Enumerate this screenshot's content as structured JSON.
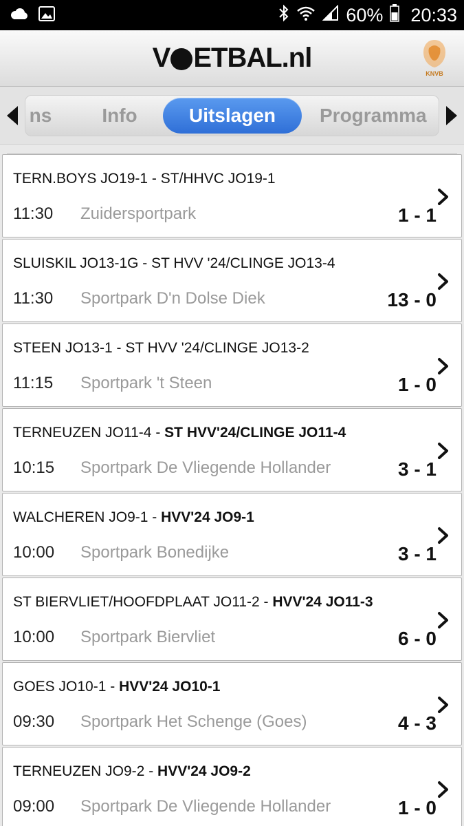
{
  "status_bar": {
    "battery_percent": "60%",
    "time": "20:33",
    "icons": [
      "cloud-icon",
      "image-icon",
      "bluetooth-icon",
      "wifi-icon",
      "signal-icon",
      "battery-icon"
    ]
  },
  "header": {
    "logo_text_pre": "V",
    "logo_text_post": "ETBAL",
    "logo_tld": ".nl",
    "badge_label": "KNVB"
  },
  "tabs": {
    "items": [
      {
        "label": "ns"
      },
      {
        "label": "Info"
      },
      {
        "label": "Uitslagen"
      },
      {
        "label": "Programma"
      }
    ],
    "active": "Uitslagen"
  },
  "matches": [
    {
      "home": "TERN.BOYS JO19-1",
      "separator": " - ",
      "away": "ST/HHVC JO19-1",
      "bold": "",
      "time": "11:30",
      "venue": "Zuidersportpark",
      "score": "1 - 1"
    },
    {
      "home": "SLUISKIL JO13-1G",
      "separator": " - ",
      "away": "ST HVV '24/CLINGE JO13-4",
      "bold": "",
      "time": "11:30",
      "venue": "Sportpark D'n Dolse Diek",
      "score": "13 - 0"
    },
    {
      "home": "STEEN JO13-1",
      "separator": " - ",
      "away": "ST HVV '24/CLINGE JO13-2",
      "bold": "",
      "time": "11:15",
      "venue": "Sportpark 't Steen",
      "score": "1 - 0"
    },
    {
      "home": "TERNEUZEN JO11-4",
      "separator": " - ",
      "away": "",
      "bold": "ST HVV'24/CLINGE JO11-4",
      "time": "10:15",
      "venue": "Sportpark De Vliegende Hollander",
      "score": "3 - 1"
    },
    {
      "home": "WALCHEREN JO9-1",
      "separator": " - ",
      "away": "",
      "bold": "HVV'24 JO9-1",
      "time": "10:00",
      "venue": "Sportpark Bonedijke",
      "score": "3 - 1"
    },
    {
      "home": "ST BIERVLIET/HOOFDPLAAT JO11-2",
      "separator": " - ",
      "away": "",
      "bold": "HVV'24 JO11-3",
      "time": "10:00",
      "venue": "Sportpark Biervliet",
      "score": "6 - 0"
    },
    {
      "home": "GOES JO10-1",
      "separator": " - ",
      "away": "",
      "bold": "HVV'24 JO10-1",
      "time": "09:30",
      "venue": "Sportpark Het Schenge (Goes)",
      "score": "4 - 3"
    },
    {
      "home": "TERNEUZEN JO9-2",
      "separator": " - ",
      "away": "",
      "bold": "HVV'24 JO9-2",
      "time": "09:00",
      "venue": "Sportpark De Vliegende Hollander",
      "score": "1 - 0"
    }
  ]
}
